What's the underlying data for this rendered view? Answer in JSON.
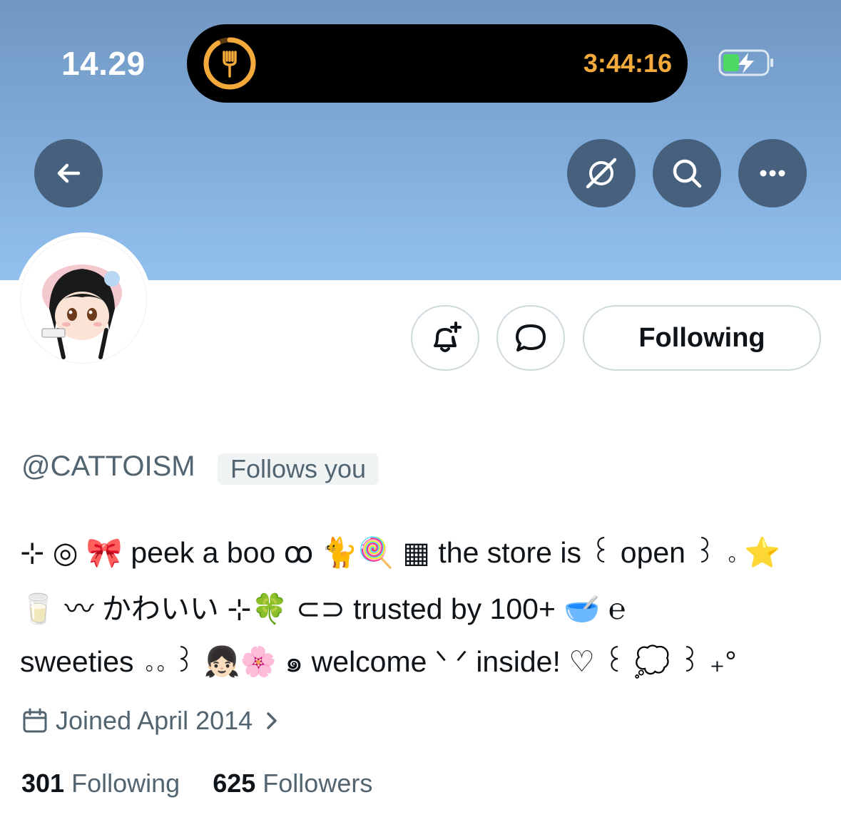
{
  "status_bar": {
    "time": "14.29",
    "live_activity_timer": "3:44:16",
    "live_activity_icon": "fork-icon",
    "battery_state": "charging"
  },
  "banner": {
    "color_top": "#7197c1",
    "color_bottom": "#92c1ef"
  },
  "header_actions": {
    "back_icon": "arrow-left-icon",
    "grok_icon": "grok-icon",
    "search_icon": "search-icon",
    "more_icon": "more-icon"
  },
  "profile": {
    "handle": "@CATTOISM",
    "follows_you": "Follows you",
    "following_button": "Following",
    "bio_lines": [
      "⊹ ◎ 🎀 peek a boo ꝏ 🐈🍭 ▦ the store is ꒰ open ꒱ ｡ ⭐",
      "🥛 〰 かわいい ⊹🍀 ⊂⊃ trusted by 100+ 🥣 ℮",
      "sweeties ｡｡ ꒱ 👧🏻🌸 ๑ welcome ᐠ ᐟ inside! ♡ ꒰ 💭 ꒱ ₊°"
    ],
    "joined": "Joined April 2014",
    "following_count": "301",
    "following_label": "Following",
    "followers_count": "625",
    "followers_label": "Followers"
  },
  "colors": {
    "accent_timer": "#f4a93b",
    "button_dark": "#46607d",
    "muted_text": "#536471",
    "battery_green": "#4cd964"
  }
}
